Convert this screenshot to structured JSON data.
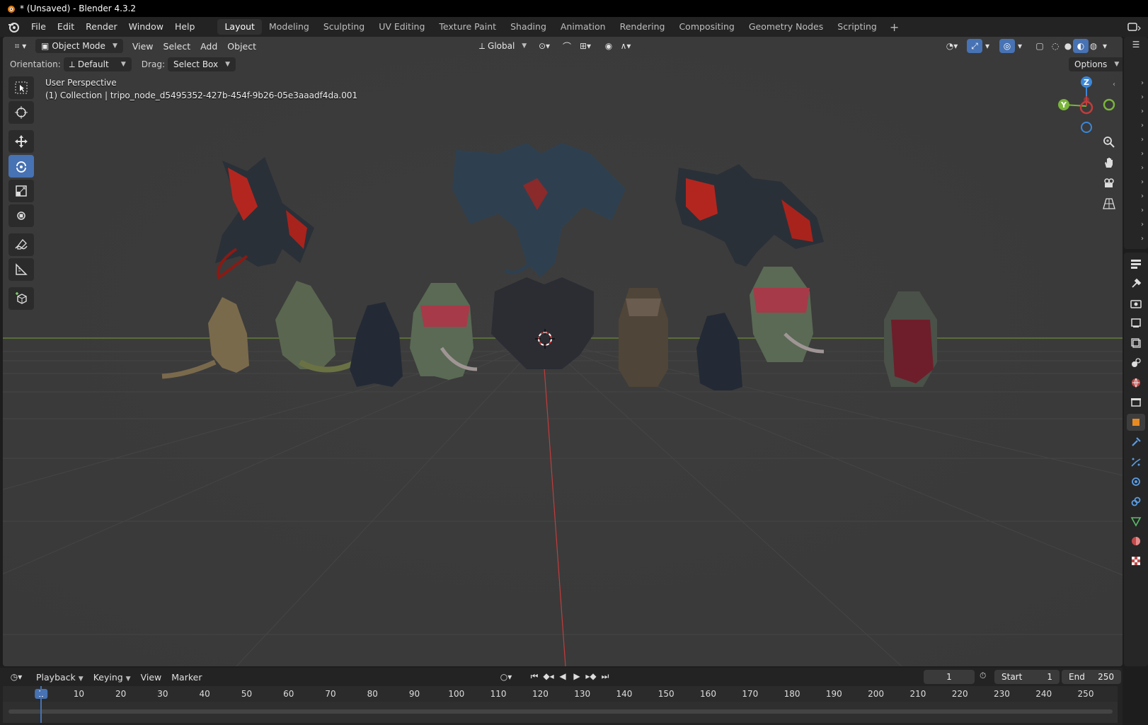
{
  "window": {
    "title": "* (Unsaved) - Blender 4.3.2"
  },
  "menu": [
    "File",
    "Edit",
    "Render",
    "Window",
    "Help"
  ],
  "workspaces": [
    "Layout",
    "Modeling",
    "Sculpting",
    "UV Editing",
    "Texture Paint",
    "Shading",
    "Animation",
    "Rendering",
    "Compositing",
    "Geometry Nodes",
    "Scripting"
  ],
  "active_workspace": "Layout",
  "viewport_header": {
    "mode": "Object Mode",
    "menus": [
      "View",
      "Select",
      "Add",
      "Object"
    ],
    "transform_orientation": "Global"
  },
  "tool_settings": {
    "orientation_label": "Orientation:",
    "orientation_value": "Default",
    "drag_label": "Drag:",
    "drag_value": "Select Box",
    "options": "Options"
  },
  "viewport_info": {
    "line1": "User Perspective",
    "line2": "(1) Collection | tripo_node_d5495352-427b-454f-9b26-05e3aaadf4da.001"
  },
  "gizmo": {
    "z": "Z",
    "y": "Y"
  },
  "timeline": {
    "menus": [
      "Playback",
      "Keying",
      "View",
      "Marker"
    ],
    "current_frame": "1",
    "start_label": "Start",
    "start_value": "1",
    "end_label": "End",
    "end_value": "250",
    "ruler": [
      "1",
      "10",
      "20",
      "30",
      "40",
      "50",
      "60",
      "70",
      "80",
      "90",
      "100",
      "110",
      "120",
      "130",
      "140",
      "150",
      "160",
      "170",
      "180",
      "190",
      "200",
      "210",
      "220",
      "230",
      "240",
      "250"
    ]
  },
  "colors": {
    "accent": "#4772b3",
    "x_axis": "#c33c3c",
    "y_axis": "#7ab53a",
    "z_axis": "#3b87d8"
  }
}
